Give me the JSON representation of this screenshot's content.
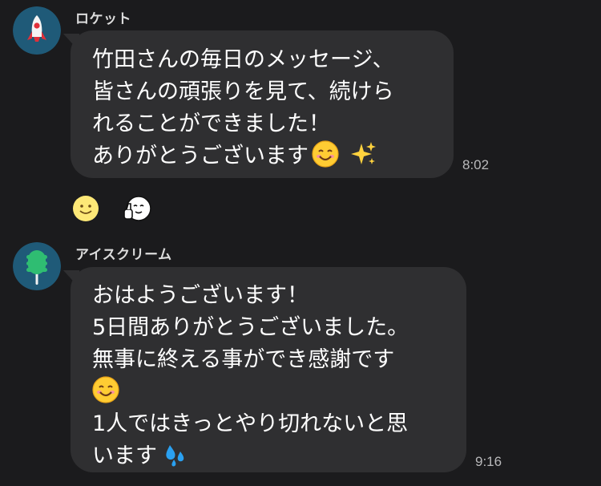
{
  "messages": [
    {
      "sender": "ロケット",
      "avatar_icon": "rocket-icon",
      "lines": [
        "竹田さんの毎日のメッセージ、",
        "皆さんの頑張りを見て、続けら",
        "れることができました！",
        "ありがとうございます"
      ],
      "trailing_emojis": [
        "smiling-face-emoji",
        "sparkles-emoji"
      ],
      "time": "8:02",
      "reactions": [
        "smiling-face-reaction-icon",
        "thumbs-up-face-reaction-icon"
      ]
    },
    {
      "sender": "アイスクリーム",
      "avatar_icon": "ice-cream-icon",
      "lines": [
        "おはようございます！",
        "5日間ありがとうございました。",
        "無事に終える事ができ感謝です",
        "",
        "1人ではきっとやり切れないと思",
        "います"
      ],
      "trailing_emojis": [
        "smiling-face-emoji",
        "sweat-droplets-emoji"
      ],
      "time": "9:16"
    }
  ],
  "colors": {
    "background": "#1b1b1d",
    "bubble": "#2f2f31",
    "avatar_bg": "#1f5a78"
  }
}
